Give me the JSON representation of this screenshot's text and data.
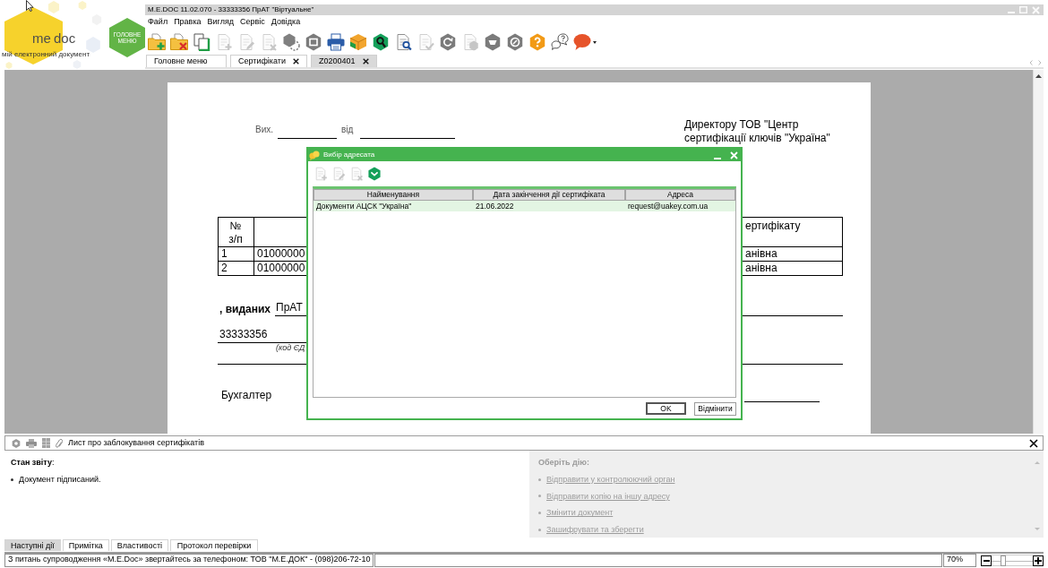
{
  "window": {
    "title": "M.E.DOC 11.02.070 - 33333356 ПрАТ \"Віртуальне\""
  },
  "logo": {
    "text_1": "me",
    "text_2": "doc",
    "tagline": "мій електронний документ"
  },
  "main_menu_button": {
    "label": "ГОЛОВНЕ МЕНЮ"
  },
  "menu": [
    "Файл",
    "Правка",
    "Вигляд",
    "Сервіс",
    "Довідка"
  ],
  "toolbar": [
    {
      "kind": "folder-add",
      "disabled": false
    },
    {
      "kind": "folder-delete",
      "disabled": false
    },
    {
      "kind": "copy",
      "disabled": false
    },
    {
      "kind": "doc-add",
      "disabled": true
    },
    {
      "kind": "doc-edit",
      "disabled": true
    },
    {
      "kind": "doc-delete",
      "disabled": true
    },
    {
      "kind": "hex-link",
      "disabled": false
    },
    {
      "kind": "hex-frame",
      "disabled": false
    },
    {
      "kind": "print",
      "disabled": false
    },
    {
      "kind": "package",
      "disabled": false
    },
    {
      "kind": "hex-search",
      "disabled": false
    },
    {
      "kind": "doc-search",
      "disabled": false
    },
    {
      "kind": "doc-check",
      "disabled": true
    },
    {
      "kind": "hex-refresh",
      "disabled": false
    },
    {
      "kind": "doc-hex",
      "disabled": true
    },
    {
      "kind": "hex-tray",
      "disabled": false
    },
    {
      "kind": "hex-dial",
      "disabled": false
    },
    {
      "kind": "help",
      "disabled": false
    },
    {
      "kind": "chat-help",
      "disabled": false
    },
    {
      "kind": "chat",
      "disabled": false
    }
  ],
  "tabs": [
    {
      "label": "Головне меню",
      "closable": false,
      "selected": false
    },
    {
      "label": "Сертифікати",
      "closable": true,
      "selected": false
    },
    {
      "label": "Z0200401",
      "closable": true,
      "selected": true
    }
  ],
  "document": {
    "outgoing_label": "Вих.",
    "date_label": "від",
    "addressee": "Директору ТОВ \"Центр сертифікації ключів \"Україна\"",
    "table": {
      "header": {
        "number": "№ з/п",
        "column_3": "ертифікату"
      },
      "rows": [
        {
          "number": "1",
          "column_2": "01000000",
          "column_3": "анівна"
        },
        {
          "number": "2",
          "column_2": "01000000",
          "column_3": "анівна"
        }
      ]
    },
    "issued_label": ", виданих",
    "issuer": "ПрАТ",
    "edrpou": "33333356",
    "edrpou_caption": "(код ЄД",
    "accountant_label": "Бухгалтер"
  },
  "dialog": {
    "title": "Вибір адресата",
    "toolbar": [
      {
        "kind": "doc-add",
        "disabled": true
      },
      {
        "kind": "doc-edit",
        "disabled": true
      },
      {
        "kind": "doc-delete",
        "disabled": true
      },
      {
        "kind": "hex-select",
        "disabled": false
      }
    ],
    "columns": [
      "Найменування",
      "Дата закінчення дії сертифіката",
      "Адреса"
    ],
    "rows": [
      {
        "name": "Документи АЦСК \"Україна\"",
        "expiry": "21.06.2022",
        "address": "request@uakey.com.ua",
        "selected": true
      }
    ],
    "buttons": [
      "OK",
      "Відмінити"
    ]
  },
  "report_panel": {
    "title": "Лист про заблокування сертифікатів",
    "status_heading": "**Стан звіту**:",
    "status_items": [
      "Документ підписаний."
    ],
    "actions_heading": "Оберіть дію:",
    "actions": [
      "Відправити у контролюючий орган",
      "Відправити копію на іншу адресу",
      "Змінити документ",
      "Зашифрувати та зберегти"
    ],
    "tabs": [
      {
        "label": "Наступні дії",
        "selected": true
      },
      {
        "label": "Примітка",
        "selected": false
      },
      {
        "label": "Властивості",
        "selected": false
      },
      {
        "label": "Протокол перевірки",
        "selected": false
      }
    ]
  },
  "status_bar": {
    "message": "З питань супроводження «M.E.Doc» звертайтесь за телефоном: ТОВ \"М.Е.ДОК\" - (098)206-72-10",
    "zoom_reading": "70%",
    "zoom": {
      "level": 0.28
    }
  }
}
